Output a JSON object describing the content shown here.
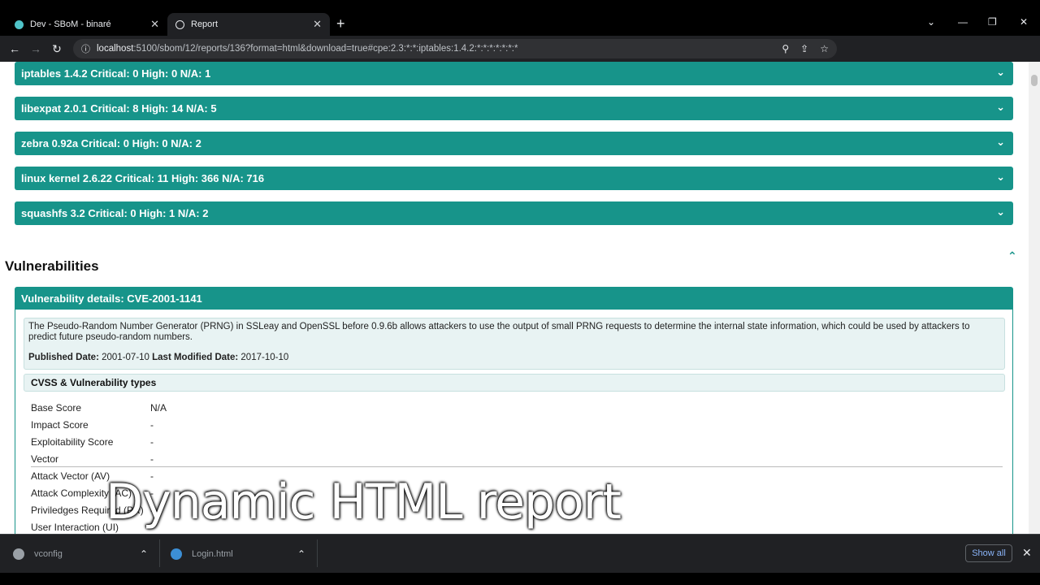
{
  "tabs": [
    {
      "title": "Dev - SBoM - binaré",
      "favicon_color": "#4fc3c8"
    },
    {
      "title": "Report",
      "favicon_color": "#e8eaed"
    }
  ],
  "address_bar": {
    "host": "localhost",
    "path": ":5100/sbom/12/reports/136?format=html&download=true#cpe:2.3:*:*:iptables:1.4.2:*:*:*:*:*:*:*"
  },
  "components": [
    {
      "label": "iptables 1.4.2 Critical: 0 High: 0 N/A: 1"
    },
    {
      "label": "libexpat 2.0.1 Critical: 8 High: 14 N/A: 5"
    },
    {
      "label": "zebra 0.92a Critical: 0 High: 0 N/A: 2"
    },
    {
      "label": "linux kernel 2.6.22 Critical: 11 High: 366 N/A: 716"
    },
    {
      "label": "squashfs 3.2 Critical: 0 High: 1 N/A: 2"
    }
  ],
  "vulnerabilities": {
    "heading": "Vulnerabilities",
    "details_title": "Vulnerability details: CVE-2001-1141",
    "description": "The Pseudo-Random Number Generator (PRNG) in SSLeay and OpenSSL before 0.9.6b allows attackers to use the output of small PRNG requests to determine the internal state information, which could be used by attackers to predict future pseudo-random numbers.",
    "published_label": "Published Date:",
    "published_value": "2001-07-10",
    "modified_label": "Last Modified Date:",
    "modified_value": "2017-10-10",
    "cvss_header": "CVSS & Vulnerability types",
    "rows": [
      {
        "label": "Base Score",
        "value": "N/A"
      },
      {
        "label": "Impact Score",
        "value": "-"
      },
      {
        "label": "Exploitability Score",
        "value": "-"
      },
      {
        "label": "Vector",
        "value": "-"
      },
      {
        "label": "Attack Vector (AV)",
        "value": "-"
      },
      {
        "label": "Attack Complexity (AC)",
        "value": "-"
      },
      {
        "label": "Priviledges Required (PR)",
        "value": "-"
      },
      {
        "label": "User Interaction (UI)",
        "value": ""
      }
    ]
  },
  "caption": "Dynamic HTML report",
  "downloads": [
    {
      "name": "vconfig"
    },
    {
      "name": "Login.html"
    }
  ],
  "downloads_show_all": "Show all",
  "colors": {
    "accent": "#17948a"
  }
}
